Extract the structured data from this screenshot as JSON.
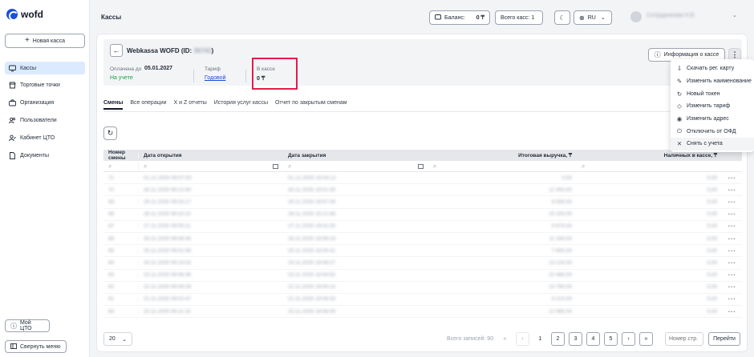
{
  "logo": "wofd",
  "sidebar": {
    "new_button": "Новая касса",
    "items": [
      {
        "label": "Кассы",
        "icon": "monitor-icon"
      },
      {
        "label": "Торговые точки",
        "icon": "store-icon"
      },
      {
        "label": "Организация",
        "icon": "briefcase-icon"
      },
      {
        "label": "Пользователи",
        "icon": "users-icon"
      },
      {
        "label": "Кабинет ЦТО",
        "icon": "person-badge-icon"
      },
      {
        "label": "Документы",
        "icon": "document-icon"
      }
    ],
    "my_cto": "Мой ЦТО",
    "collapse": "Свернуть меню"
  },
  "header": {
    "title": "Кассы",
    "balance_label": "Баланс:",
    "balance_value": "0 ₸",
    "total_label": "Всего касс: 1",
    "language": "RU",
    "user_name": "Сотрудникова Н.В."
  },
  "kassa": {
    "title": "Webkassa WOFD (ID: ",
    "id": "36743",
    "title_end": ")",
    "paid_label": "Оплачена до",
    "paid_date": "05.01.2027",
    "status": "На учете",
    "tariff_label": "Тариф",
    "tariff_value": "Годовой",
    "cash_label": "В кассе",
    "cash_value": "0 ₸",
    "info_button": "Информация о кассе"
  },
  "tabs": [
    "Смены",
    "Все операции",
    "X и Z отчеты",
    "История услуг кассы",
    "Отчет по закрытым сменам"
  ],
  "table": {
    "headers": [
      "Номер смены",
      "Дата открытия",
      "Дата закрытия",
      "Итоговая выручка, ₸",
      "Наличных в кассе, ₸"
    ],
    "rows": [
      [
        "71",
        "01.12.2025 09:07:53",
        "01.12.2025 19:04:12",
        "0,00",
        "0,00"
      ],
      [
        "70",
        "30.11.2025 09:12:40",
        "30.11.2025 19:01:35",
        "12 450,00",
        "0,00"
      ],
      [
        "69",
        "29.11.2025 09:03:17",
        "29.11.2025 18:57:06",
        "8 930,00",
        "0,00"
      ],
      [
        "68",
        "28.11.2025 09:10:22",
        "28.11.2025 19:12:48",
        "15 200,00",
        "0,00"
      ],
      [
        "67",
        "27.11.2025 09:05:11",
        "27.11.2025 19:02:30",
        "9 870,00",
        "0,00"
      ],
      [
        "66",
        "26.11.2025 09:08:45",
        "26.11.2025 18:59:19",
        "11 340,00",
        "0,00"
      ],
      [
        "65",
        "25.11.2025 09:01:58",
        "25.11.2025 19:05:41",
        "7 650,00",
        "0,00"
      ],
      [
        "64",
        "24.11.2025 09:14:03",
        "24.11.2025 19:08:27",
        "13 120,00",
        "0,00"
      ],
      [
        "63",
        "23.11.2025 09:06:36",
        "23.11.2025 18:54:52",
        "10 480,00",
        "0,00"
      ],
      [
        "62",
        "22.11.2025 09:09:29",
        "22.11.2025 19:00:14",
        "14 760,00",
        "0,00"
      ],
      [
        "61",
        "21.11.2025 09:02:47",
        "21.11.2025 19:06:33",
        "8 210,00",
        "0,00"
      ],
      [
        "60",
        "20.11.2025 09:11:15",
        "20.11.2025 18:58:09",
        "12 990,00",
        "0,00"
      ]
    ]
  },
  "pager": {
    "page_size": "20",
    "total": "Всего записей: 90",
    "pages": [
      "1",
      "2",
      "3",
      "4",
      "5"
    ],
    "page_input_placeholder": "Номер стр.",
    "go": "Перейти"
  },
  "menu": [
    {
      "label": "Скачать рег. карту",
      "icon": "download-card-icon"
    },
    {
      "label": "Изменить наименование",
      "icon": "pencil-icon"
    },
    {
      "label": "Новый токен",
      "icon": "refresh-icon"
    },
    {
      "label": "Изменить тариф",
      "icon": "tag-icon"
    },
    {
      "label": "Изменить адрес",
      "icon": "location-pin-icon"
    },
    {
      "label": "Отключить от ОФД",
      "icon": "power-icon"
    },
    {
      "label": "Снять с учета",
      "icon": "close-icon"
    }
  ]
}
